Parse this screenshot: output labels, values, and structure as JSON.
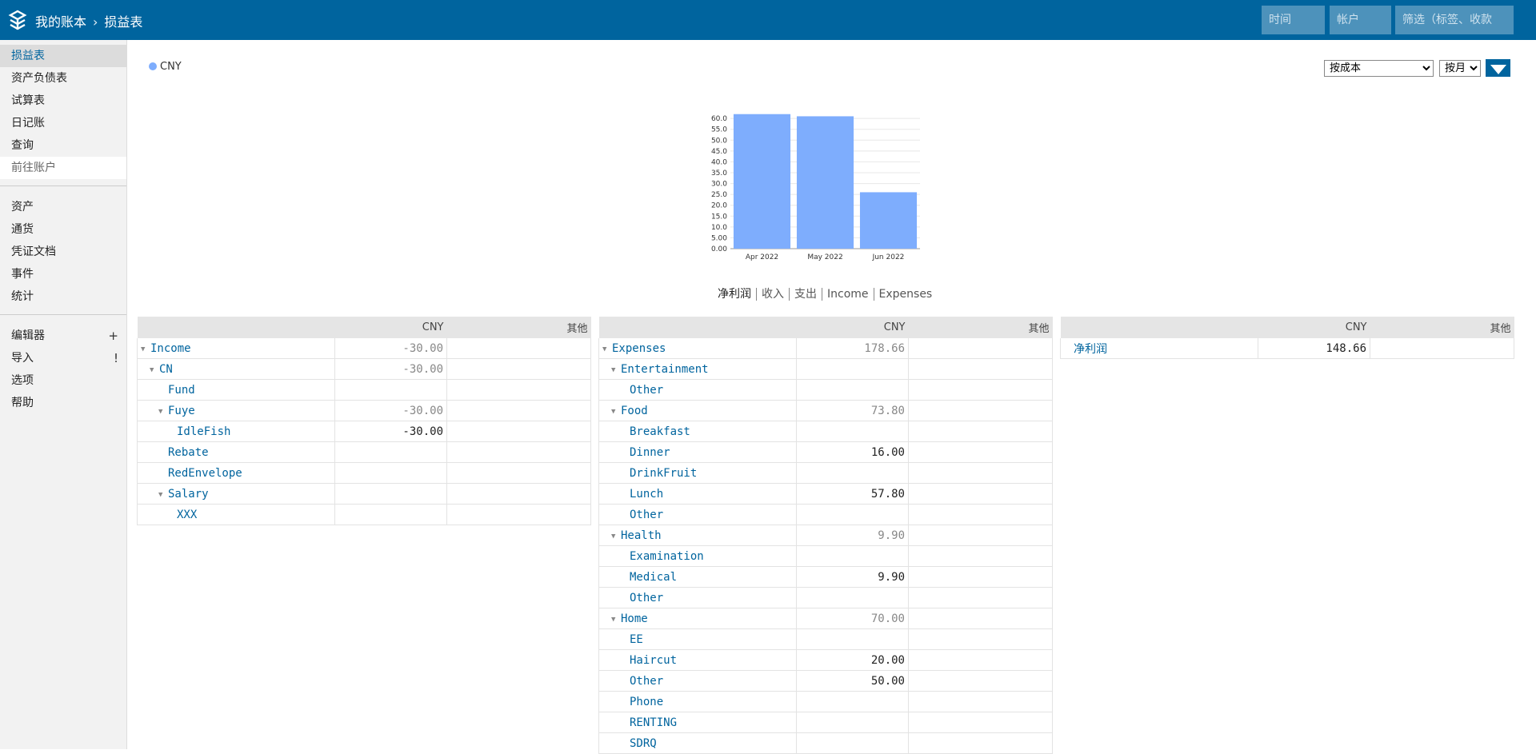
{
  "header": {
    "ledger_title": "我的账本",
    "breadcrumb_separator": "›",
    "page_title": "损益表",
    "time_placeholder": "时间",
    "account_placeholder": "帐户",
    "filter_placeholder": "筛选（标签、收款"
  },
  "sidebar": {
    "reports": [
      {
        "label": "损益表",
        "active": true
      },
      {
        "label": "资产负债表"
      },
      {
        "label": "试算表"
      },
      {
        "label": "日记账"
      },
      {
        "label": "查询"
      },
      {
        "label": "前往账户"
      }
    ],
    "sections": [
      {
        "label": "资产"
      },
      {
        "label": "通货"
      },
      {
        "label": "凭证文档"
      },
      {
        "label": "事件"
      },
      {
        "label": "统计"
      }
    ],
    "tools": [
      {
        "label": "编辑器",
        "icon": "plus-icon",
        "glyph": "+"
      },
      {
        "label": "导入",
        "icon": "info-icon",
        "glyph": "!"
      },
      {
        "label": "选项"
      },
      {
        "label": "帮助"
      }
    ]
  },
  "controls": {
    "currency_legend": "CNY",
    "conversion": "按成本",
    "interval": "按月",
    "filter_icon": "triangle-down-icon"
  },
  "chart_modes": [
    "净利润",
    "收入",
    "支出",
    "Income",
    "Expenses"
  ],
  "chart_data": {
    "type": "bar",
    "categories": [
      "Apr 2022",
      "May 2022",
      "Jun 2022"
    ],
    "series": [
      {
        "name": "CNY",
        "values": [
          62.0,
          61.0,
          26.0
        ]
      }
    ],
    "ylim": [
      0,
      63
    ],
    "yticks": [
      "0.00",
      "5.00",
      "10.0",
      "15.0",
      "20.0",
      "25.0",
      "30.0",
      "35.0",
      "40.0",
      "45.0",
      "50.0",
      "55.0",
      "60.0"
    ],
    "grid": true,
    "color": "#7eadfd"
  },
  "tables": {
    "income": {
      "headers": [
        "CNY",
        "其他"
      ],
      "rows": [
        {
          "name": "Income",
          "depth": 0,
          "toggle": true,
          "cny": "-30.00",
          "agg": true
        },
        {
          "name": "CN",
          "depth": 1,
          "toggle": true,
          "cny": "-30.00",
          "agg": true
        },
        {
          "name": "Fund",
          "depth": 2,
          "toggle": false,
          "cny": ""
        },
        {
          "name": "Fuye",
          "depth": 2,
          "toggle": true,
          "cny": "-30.00",
          "agg": true
        },
        {
          "name": "IdleFish",
          "depth": 3,
          "toggle": false,
          "cny": "-30.00"
        },
        {
          "name": "Rebate",
          "depth": 2,
          "toggle": false,
          "cny": ""
        },
        {
          "name": "RedEnvelope",
          "depth": 2,
          "toggle": false,
          "cny": ""
        },
        {
          "name": "Salary",
          "depth": 2,
          "toggle": true,
          "cny": ""
        },
        {
          "name": "XXX",
          "depth": 3,
          "toggle": false,
          "cny": ""
        }
      ]
    },
    "expenses": {
      "headers": [
        "CNY",
        "其他"
      ],
      "rows": [
        {
          "name": "Expenses",
          "depth": 0,
          "toggle": true,
          "cny": "178.66",
          "agg": true
        },
        {
          "name": "Entertainment",
          "depth": 1,
          "toggle": true,
          "cny": ""
        },
        {
          "name": "Other",
          "depth": 2,
          "toggle": false,
          "cny": ""
        },
        {
          "name": "Food",
          "depth": 1,
          "toggle": true,
          "cny": "73.80",
          "agg": true
        },
        {
          "name": "Breakfast",
          "depth": 2,
          "toggle": false,
          "cny": ""
        },
        {
          "name": "Dinner",
          "depth": 2,
          "toggle": false,
          "cny": "16.00"
        },
        {
          "name": "DrinkFruit",
          "depth": 2,
          "toggle": false,
          "cny": ""
        },
        {
          "name": "Lunch",
          "depth": 2,
          "toggle": false,
          "cny": "57.80"
        },
        {
          "name": "Other",
          "depth": 2,
          "toggle": false,
          "cny": ""
        },
        {
          "name": "Health",
          "depth": 1,
          "toggle": true,
          "cny": "9.90",
          "agg": true
        },
        {
          "name": "Examination",
          "depth": 2,
          "toggle": false,
          "cny": ""
        },
        {
          "name": "Medical",
          "depth": 2,
          "toggle": false,
          "cny": "9.90"
        },
        {
          "name": "Other",
          "depth": 2,
          "toggle": false,
          "cny": ""
        },
        {
          "name": "Home",
          "depth": 1,
          "toggle": true,
          "cny": "70.00",
          "agg": true
        },
        {
          "name": "EE",
          "depth": 2,
          "toggle": false,
          "cny": ""
        },
        {
          "name": "Haircut",
          "depth": 2,
          "toggle": false,
          "cny": "20.00"
        },
        {
          "name": "Other",
          "depth": 2,
          "toggle": false,
          "cny": "50.00"
        },
        {
          "name": "Phone",
          "depth": 2,
          "toggle": false,
          "cny": ""
        },
        {
          "name": "RENTING",
          "depth": 2,
          "toggle": false,
          "cny": ""
        },
        {
          "name": "SDRQ",
          "depth": 2,
          "toggle": false,
          "cny": ""
        }
      ]
    },
    "net_profit": {
      "headers": [
        "CNY",
        "其他"
      ],
      "rows": [
        {
          "name": "净利润",
          "depth": 0,
          "toggle": false,
          "cny": "148.66"
        }
      ]
    }
  }
}
